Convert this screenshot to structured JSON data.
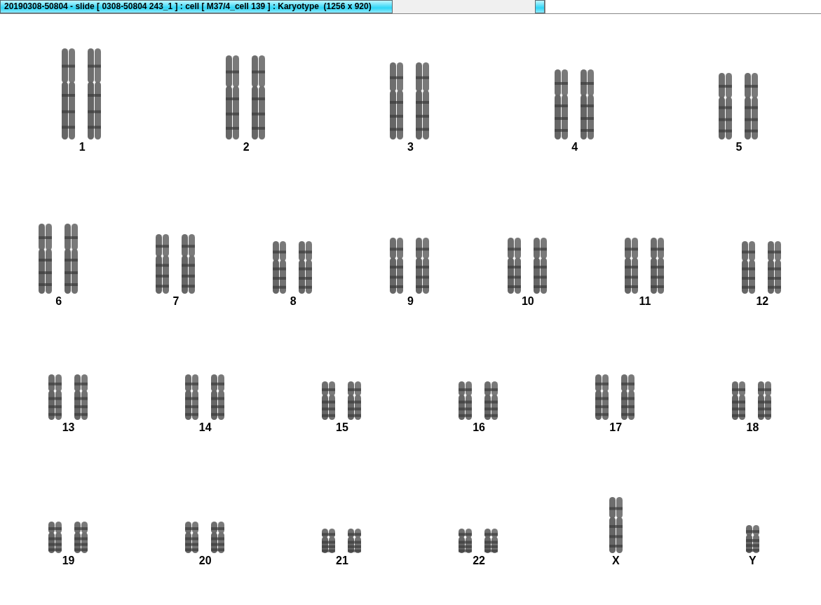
{
  "window": {
    "title": "20190308-50804 - slide [ 0308-50804 243_1 ] : cell [ M37/4_cell 139 ] : Karyotype  (1256 x 920)"
  },
  "karyotype": {
    "rows": [
      [
        {
          "label": "1",
          "kind": "pair"
        },
        {
          "label": "2",
          "kind": "pair"
        },
        {
          "label": "3",
          "kind": "pair"
        },
        {
          "label": "4",
          "kind": "pair"
        },
        {
          "label": "5",
          "kind": "pair"
        }
      ],
      [
        {
          "label": "6",
          "kind": "pair"
        },
        {
          "label": "7",
          "kind": "pair"
        },
        {
          "label": "8",
          "kind": "pair"
        },
        {
          "label": "9",
          "kind": "pair"
        },
        {
          "label": "10",
          "kind": "pair"
        },
        {
          "label": "11",
          "kind": "pair"
        },
        {
          "label": "12",
          "kind": "pair"
        }
      ],
      [
        {
          "label": "13",
          "kind": "pair"
        },
        {
          "label": "14",
          "kind": "pair"
        },
        {
          "label": "15",
          "kind": "pair"
        },
        {
          "label": "16",
          "kind": "pair"
        },
        {
          "label": "17",
          "kind": "pair"
        },
        {
          "label": "18",
          "kind": "pair"
        }
      ],
      [
        {
          "label": "19",
          "kind": "pair"
        },
        {
          "label": "20",
          "kind": "pair"
        },
        {
          "label": "21",
          "kind": "pair"
        },
        {
          "label": "22",
          "kind": "pair"
        },
        {
          "label": "X",
          "kind": "single"
        },
        {
          "label": "Y",
          "kind": "single"
        }
      ]
    ]
  }
}
